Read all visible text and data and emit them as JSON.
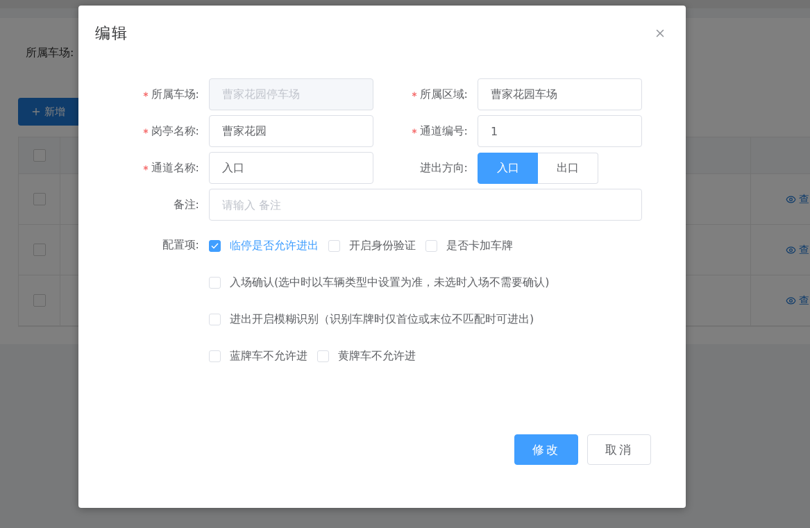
{
  "background": {
    "filter_label": "所属车场:",
    "add_button": "新增",
    "table": {
      "header_checked": false,
      "rows": [
        {
          "checked": false,
          "action": "查"
        },
        {
          "checked": false,
          "action": "查"
        },
        {
          "checked": false,
          "action": "查"
        }
      ]
    }
  },
  "dialog": {
    "title": "编辑",
    "rows": [
      [
        {
          "kind": "input",
          "label": "所属车场:",
          "required": true,
          "value": "曹家花园停车场",
          "disabled": true
        },
        {
          "kind": "input",
          "label": "所属区域:",
          "required": true,
          "value": "曹家花园车场",
          "disabled": false
        }
      ],
      [
        {
          "kind": "input",
          "label": "岗亭名称:",
          "required": true,
          "value": "曹家花园",
          "disabled": false
        },
        {
          "kind": "input",
          "label": "通道编号:",
          "required": true,
          "value": "1",
          "disabled": false
        }
      ],
      [
        {
          "kind": "input",
          "label": "通道名称:",
          "required": true,
          "value": "入口",
          "disabled": false
        },
        {
          "kind": "segmented",
          "label": "进出方向:",
          "required": false,
          "options": [
            {
              "label": "入口",
              "selected": true
            },
            {
              "label": "出口",
              "selected": false
            }
          ]
        }
      ],
      [
        {
          "kind": "wide",
          "label": "备注:",
          "required": false,
          "placeholder": "请输入 备注"
        }
      ]
    ],
    "config": {
      "label": "配置项:",
      "lines": [
        [
          {
            "label": "临停是否允许进出",
            "checked": true
          },
          {
            "label": "开启身份验证",
            "checked": false
          },
          {
            "label": "是否卡加车牌",
            "checked": false
          }
        ],
        [
          {
            "label": "入场确认(选中时以车辆类型中设置为准，未选时入场不需要确认)",
            "checked": false
          }
        ],
        [
          {
            "label": "进出开启模糊识别（识别车牌时仅首位或末位不匹配时可进出)",
            "checked": false
          }
        ],
        [
          {
            "label": "蓝牌车不允许进",
            "checked": false
          },
          {
            "label": "黄牌车不允许进",
            "checked": false
          }
        ]
      ]
    },
    "buttons": [
      {
        "kind": "primary",
        "label": "修改"
      },
      {
        "kind": "default",
        "label": "取消"
      }
    ]
  }
}
